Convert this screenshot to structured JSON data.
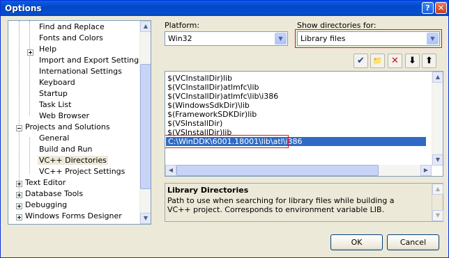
{
  "window": {
    "title": "Options",
    "help_glyph": "?",
    "close_glyph": "✕"
  },
  "tree": {
    "items": [
      {
        "label": "Find and Replace"
      },
      {
        "label": "Fonts and Colors"
      },
      {
        "label": "Help"
      },
      {
        "label": "Import and Export Settings"
      },
      {
        "label": "International Settings"
      },
      {
        "label": "Keyboard"
      },
      {
        "label": "Startup"
      },
      {
        "label": "Task List"
      },
      {
        "label": "Web Browser"
      },
      {
        "label": "Projects and Solutions"
      },
      {
        "label": "General"
      },
      {
        "label": "Build and Run"
      },
      {
        "label": "VC++ Directories"
      },
      {
        "label": "VC++ Project Settings"
      },
      {
        "label": "Text Editor"
      },
      {
        "label": "Database Tools"
      },
      {
        "label": "Debugging"
      },
      {
        "label": "Windows Forms Designer"
      }
    ],
    "selected": "VC++ Directories"
  },
  "platform": {
    "label": "Platform:",
    "value": "Win32"
  },
  "show_dirs": {
    "label": "Show directories for:",
    "value": "Library files"
  },
  "toolbar": {
    "check": "✔",
    "new_folder": "📁",
    "delete": "✕",
    "down": "⬇",
    "up": "⬆"
  },
  "dir_list": {
    "items": [
      "$(VCInstallDir)lib",
      "$(VCInstallDir)atlmfc\\lib",
      "$(VCInstallDir)atlmfc\\lib\\i386",
      "$(WindowsSdkDir)\\lib",
      "$(FrameworkSDKDir)lib",
      "$(VSInstallDir)",
      "$(VSInstallDir)lib",
      "C:\\WinDDK\\6001.18001\\lib\\atl\\i386"
    ]
  },
  "description": {
    "title": "Library Directories",
    "text": "Path to use when searching for library files while building a VC++ project. Corresponds to environment variable LIB."
  },
  "buttons": {
    "ok": "OK",
    "cancel": "Cancel"
  },
  "colors": {
    "selection": "#316ac5",
    "highlight_box": "#e0141e",
    "titlebar": "#0447c6"
  }
}
